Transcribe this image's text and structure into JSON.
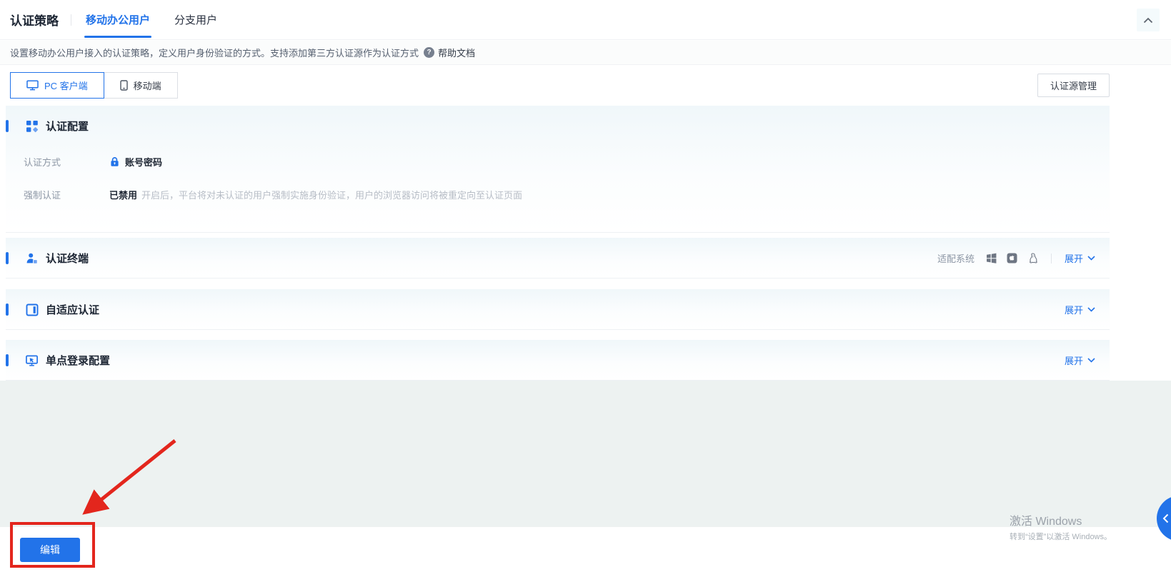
{
  "header": {
    "title": "认证策略",
    "tabs": [
      {
        "label": "移动办公用户",
        "active": true
      },
      {
        "label": "分支用户",
        "active": false
      }
    ]
  },
  "description": {
    "text": "设置移动办公用户接入的认证策略，定义用户身份验证的方式。支持添加第三方认证源作为认证方式",
    "help_glyph": "?",
    "help_link": "帮助文档"
  },
  "toolbar": {
    "device_tabs": [
      {
        "label": "PC 客户端",
        "icon": "monitor-icon",
        "active": true
      },
      {
        "label": "移动端",
        "icon": "mobile-icon",
        "active": false
      }
    ],
    "manage_button": "认证源管理"
  },
  "sections": [
    {
      "title": "认证配置",
      "icon": "grid-icon",
      "rows": [
        {
          "label": "认证方式",
          "icon": "lock-icon",
          "value": "账号密码"
        },
        {
          "label": "强制认证",
          "status": "已禁用",
          "desc": "开启后，平台将对未认证的用户强制实施身份验证，用户的浏览器访问将被重定向至认证页面"
        }
      ]
    },
    {
      "title": "认证终端",
      "icon": "user-icon",
      "os_label": "适配系统",
      "os_icons": [
        "windows-icon",
        "macos-icon",
        "linux-icon"
      ],
      "expand_label": "展开"
    },
    {
      "title": "自适应认证",
      "icon": "window-icon",
      "expand_label": "展开"
    },
    {
      "title": "单点登录配置",
      "icon": "sso-icon",
      "expand_label": "展开"
    }
  ],
  "footer": {
    "edit_button": "编辑"
  },
  "watermark": {
    "line1": "激活 Windows",
    "line2": "转到“设置”以激活 Windows。"
  },
  "colors": {
    "accent_blue": "#2273e9",
    "annotation_red": "#e3261d",
    "gray_zone_bg": "#edf2f1",
    "icon_gray": "#6e7683"
  }
}
